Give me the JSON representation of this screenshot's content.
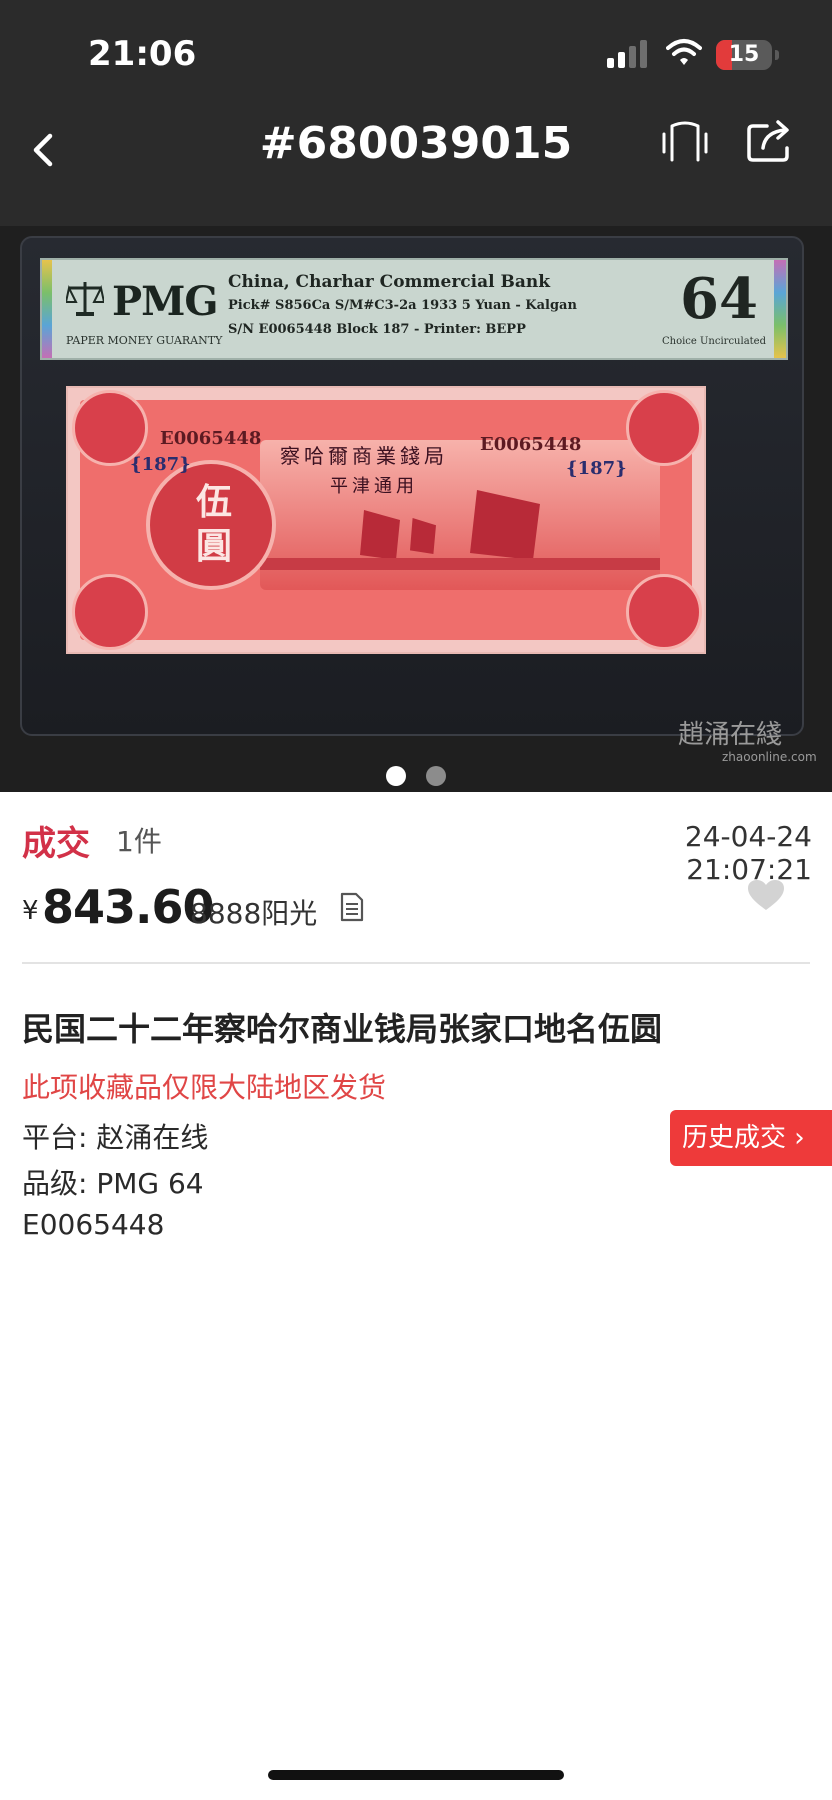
{
  "status_bar": {
    "time": "21:06",
    "battery": "15",
    "icons": [
      "signal-icon",
      "wifi-icon",
      "battery-icon"
    ]
  },
  "nav": {
    "title": "#680039015",
    "back_icon": "back-icon",
    "vibrate_icon": "vibrate-icon",
    "share_icon": "share-icon"
  },
  "image": {
    "pmg_brand": "PMG",
    "pmg_guarantee": "PAPER MONEY GUARANTY",
    "label_line1": "China, Charhar Commercial Bank",
    "label_line2": "Pick# S856Ca  S/M#C3-2a    1933  5 Yuan - Kalgan",
    "label_line3": "S/N E0065448 Block 187 - Printer: BEPP",
    "grade": "64",
    "grade_desc": "Choice Uncirculated",
    "note_serial": "E0065448",
    "note_block": "{187}",
    "note_bank": "察哈爾商業錢局",
    "note_place": "平津通用",
    "note_denom": "伍圓",
    "watermark": "趙涌在綫",
    "watermark_sub": "zhaoonline.com",
    "page_count": 2,
    "current_page": 1
  },
  "deal": {
    "tag": "成交",
    "count": "1件",
    "time": "24-04-24 21:07:21",
    "currency": "¥",
    "price": "843.60",
    "buyer": "8888阳光"
  },
  "item": {
    "title": "民国二十二年察哈尔商业钱局张家口地名伍圆",
    "notice": "此项收藏品仅限大陆地区发货",
    "platform": "平台: 赵涌在线",
    "grade": "品级: PMG 64",
    "serial": "E0065448",
    "history_button": "历史成交 ›"
  },
  "colors": {
    "header_bg": "#2b2b2b",
    "accent_red": "#d23148",
    "notice_red": "#e04646",
    "button_red": "#ee3a3a"
  }
}
